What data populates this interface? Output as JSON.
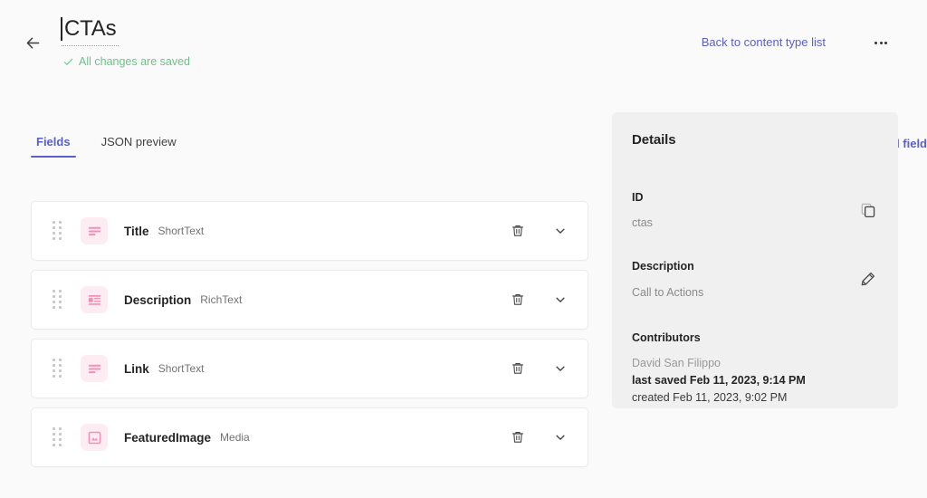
{
  "header": {
    "back_icon": "arrow-left-icon",
    "title": "CTAs",
    "saved_status": "All changes are saved",
    "saved_check_icon": "check-icon",
    "back_link": "Back to content type list",
    "more_icon": "ellipsis-icon",
    "saved_color": "#6fc08c",
    "link_color": "#5b5fc7"
  },
  "main": {
    "tabs": [
      {
        "label": "Fields",
        "active": true
      },
      {
        "label": "JSON preview",
        "active": false
      }
    ],
    "add_field": {
      "plus": "+",
      "label": "Add field",
      "icon": "plus-icon"
    },
    "row_actions": {
      "delete_icon": "trash-icon",
      "expand_icon": "chevron-down-icon"
    },
    "drag_icon": "drag-handle-icon",
    "fields": [
      {
        "name": "Title",
        "type": "ShortText",
        "icon": "short-text-icon"
      },
      {
        "name": "Description",
        "type": "RichText",
        "icon": "rich-text-icon"
      },
      {
        "name": "Link",
        "type": "ShortText",
        "icon": "short-text-icon"
      },
      {
        "name": "FeaturedImage",
        "type": "Media",
        "icon": "media-image-icon"
      }
    ]
  },
  "details": {
    "title": "Details",
    "id": {
      "label": "ID",
      "value": "ctas",
      "icon": "copy-icon"
    },
    "description": {
      "label": "Description",
      "value": "Call to Actions",
      "icon": "pencil-edit-icon"
    },
    "contributors": {
      "label": "Contributors",
      "name": "David San Filippo",
      "last_saved": "last saved Feb 11, 2023, 9:14 PM",
      "created": "created Feb 11, 2023, 9:02 PM"
    }
  },
  "theme": {
    "page_bg": "#fafafa",
    "panel_bg": "#f0f0f0",
    "accent": "#5b5fc7",
    "field_icon_bg": "#fdecf2",
    "field_icon_fg": "#f48fb6"
  }
}
